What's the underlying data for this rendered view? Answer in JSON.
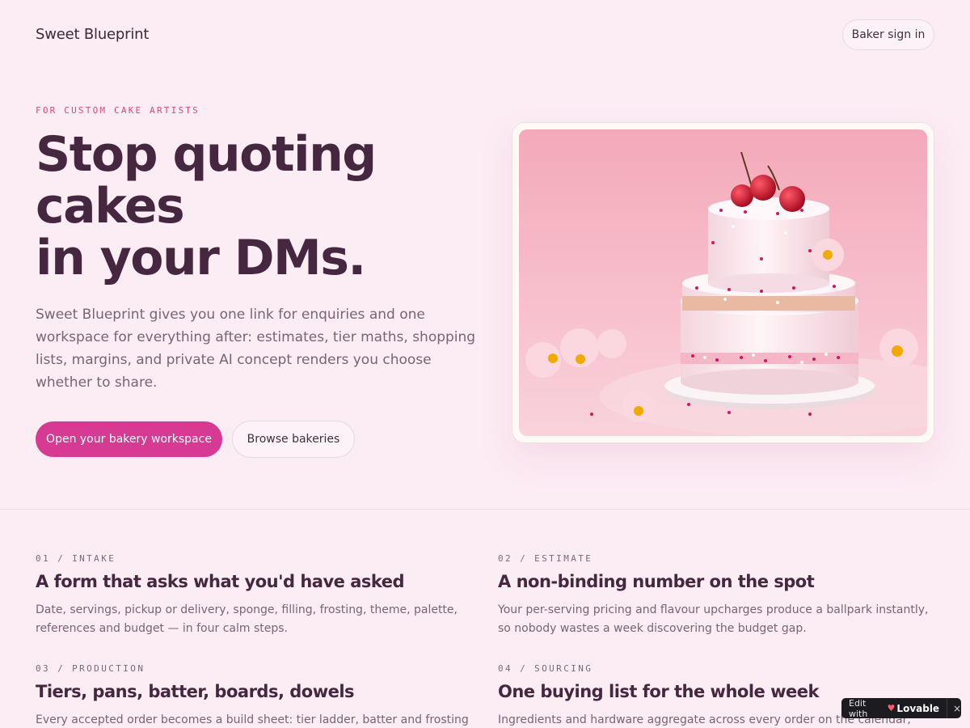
{
  "nav": {
    "brand": "Sweet Blueprint",
    "signin_label": "Baker sign in"
  },
  "hero": {
    "eyebrow": "FOR CUSTOM CAKE ARTISTS",
    "headline_line1": "Stop quoting",
    "headline_line2": "cakes",
    "headline_line3": "in your DMs.",
    "lede": "Sweet Blueprint gives you one link for enquiries and one workspace for everything after: estimates, tier maths, shopping lists, margins, and private AI concept renders you choose whether to share.",
    "primary_cta": "Open your bakery workspace",
    "secondary_cta": "Browse bakeries"
  },
  "features": [
    {
      "number": "01 / INTAKE",
      "title": "A form that asks what you'd have asked",
      "description": "Date, servings, pickup or delivery, sponge, filling, frosting, theme, palette, references and budget — in four calm steps."
    },
    {
      "number": "02 / ESTIMATE",
      "title": "A non-binding number on the spot",
      "description": "Your per-serving pricing and flavour upcharges produce a ballpark instantly, so nobody wastes a week discovering the budget gap."
    },
    {
      "number": "03 / PRODUCTION",
      "title": "Tiers, pans, batter, boards, dowels",
      "description": "Every accepted order becomes a build sheet: tier ladder, batter and frosting volume,"
    },
    {
      "number": "04 / SOURCING",
      "title": "One buying list for the whole week",
      "description": "Ingredients and hardware aggregate across every order on the calendar, with unit"
    }
  ],
  "badge": {
    "edit_with": "Edit with",
    "brand": "Lovable",
    "close": "×"
  },
  "colors": {
    "background": "#fcecf4",
    "accent": "#d73a93",
    "eyebrow": "#d9497f",
    "heading": "#45283f"
  }
}
